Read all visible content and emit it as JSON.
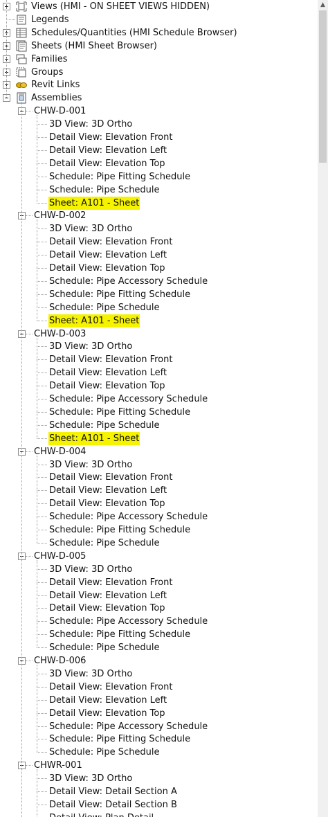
{
  "top_items": [
    {
      "label": "Views (HMI - ON SHEET VIEWS HIDDEN)",
      "icon": "views-icon",
      "expander": "plus"
    },
    {
      "label": "Legends",
      "icon": "legends-icon",
      "expander": "none"
    },
    {
      "label": "Schedules/Quantities (HMI Schedule Browser)",
      "icon": "schedules-icon",
      "expander": "plus"
    },
    {
      "label": "Sheets (HMI Sheet Browser)",
      "icon": "sheets-icon",
      "expander": "plus"
    },
    {
      "label": "Families",
      "icon": "families-icon",
      "expander": "plus"
    },
    {
      "label": "Groups",
      "icon": "groups-icon",
      "expander": "plus"
    },
    {
      "label": "Revit Links",
      "icon": "revit-links-icon",
      "expander": "plus"
    },
    {
      "label": "Assemblies",
      "icon": "assemblies-icon",
      "expander": "minus"
    }
  ],
  "assemblies": [
    {
      "name": "CHW-D-001",
      "children": [
        {
          "label": "3D View: 3D Ortho"
        },
        {
          "label": "Detail View: Elevation Front"
        },
        {
          "label": "Detail View: Elevation Left"
        },
        {
          "label": "Detail View: Elevation Top"
        },
        {
          "label": "Schedule: Pipe Fitting Schedule"
        },
        {
          "label": "Schedule: Pipe Schedule"
        },
        {
          "label": "Sheet: A101 - Sheet",
          "highlight": true
        }
      ]
    },
    {
      "name": "CHW-D-002",
      "children": [
        {
          "label": "3D View: 3D Ortho"
        },
        {
          "label": "Detail View: Elevation Front"
        },
        {
          "label": "Detail View: Elevation Left"
        },
        {
          "label": "Detail View: Elevation Top"
        },
        {
          "label": "Schedule: Pipe Accessory Schedule"
        },
        {
          "label": "Schedule: Pipe Fitting Schedule"
        },
        {
          "label": "Schedule: Pipe Schedule"
        },
        {
          "label": "Sheet: A101 - Sheet",
          "highlight": true
        }
      ]
    },
    {
      "name": "CHW-D-003",
      "children": [
        {
          "label": "3D View: 3D Ortho"
        },
        {
          "label": "Detail View: Elevation Front"
        },
        {
          "label": "Detail View: Elevation Left"
        },
        {
          "label": "Detail View: Elevation Top"
        },
        {
          "label": "Schedule: Pipe Accessory Schedule"
        },
        {
          "label": "Schedule: Pipe Fitting Schedule"
        },
        {
          "label": "Schedule: Pipe Schedule"
        },
        {
          "label": "Sheet: A101 - Sheet",
          "highlight": true
        }
      ]
    },
    {
      "name": "CHW-D-004",
      "children": [
        {
          "label": "3D View: 3D Ortho"
        },
        {
          "label": "Detail View: Elevation Front"
        },
        {
          "label": "Detail View: Elevation Left"
        },
        {
          "label": "Detail View: Elevation Top"
        },
        {
          "label": "Schedule: Pipe Accessory Schedule"
        },
        {
          "label": "Schedule: Pipe Fitting Schedule"
        },
        {
          "label": "Schedule: Pipe Schedule"
        }
      ]
    },
    {
      "name": "CHW-D-005",
      "children": [
        {
          "label": "3D View: 3D Ortho"
        },
        {
          "label": "Detail View: Elevation Front"
        },
        {
          "label": "Detail View: Elevation Left"
        },
        {
          "label": "Detail View: Elevation Top"
        },
        {
          "label": "Schedule: Pipe Accessory Schedule"
        },
        {
          "label": "Schedule: Pipe Fitting Schedule"
        },
        {
          "label": "Schedule: Pipe Schedule"
        }
      ]
    },
    {
      "name": "CHW-D-006",
      "children": [
        {
          "label": "3D View: 3D Ortho"
        },
        {
          "label": "Detail View: Elevation Front"
        },
        {
          "label": "Detail View: Elevation Left"
        },
        {
          "label": "Detail View: Elevation Top"
        },
        {
          "label": "Schedule: Pipe Accessory Schedule"
        },
        {
          "label": "Schedule: Pipe Fitting Schedule"
        },
        {
          "label": "Schedule: Pipe Schedule"
        }
      ]
    },
    {
      "name": "CHWR-001",
      "children": [
        {
          "label": "3D View: 3D Ortho"
        },
        {
          "label": "Detail View: Detail Section A"
        },
        {
          "label": "Detail View: Detail Section B"
        },
        {
          "label": "Detail View: Plan Detail"
        }
      ]
    }
  ],
  "colors": {
    "highlight": "#f6f300",
    "connector": "#9a9a9a",
    "scrollbar_track": "#f0f0f0",
    "scrollbar_thumb": "#cdcdcd"
  },
  "scrollbar": {
    "up_arrow": "▲"
  }
}
